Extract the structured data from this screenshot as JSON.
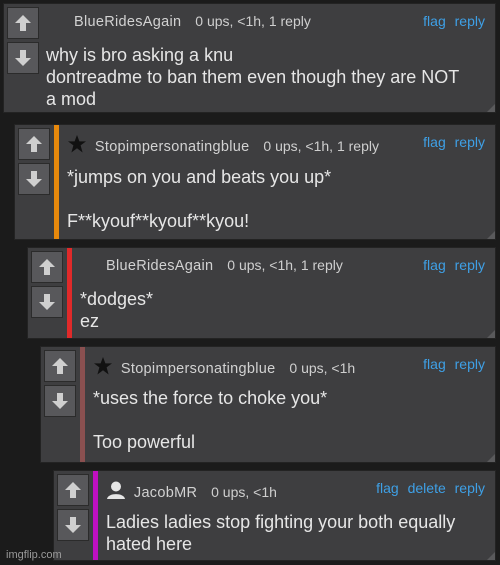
{
  "comments": [
    {
      "user": "BlueRidesAgain",
      "meta": "0 ups, <1h, 1 reply",
      "flag": "flag",
      "delete": "",
      "reply": "reply",
      "text": "why is bro asking a knu\ndontreadme to ban them even though they are NOT\na mod",
      "accent": "#3e3e40",
      "icon": "none"
    },
    {
      "user": "Stopimpersonatingblue",
      "meta": "0 ups, <1h, 1 reply",
      "flag": "flag",
      "delete": "",
      "reply": "reply",
      "text": "*jumps on you and beats you up*\n\nF**kyouf**kyouf**kyou!",
      "accent": "#e8890c",
      "icon": "star-icon"
    },
    {
      "user": "BlueRidesAgain",
      "meta": "0 ups, <1h, 1 reply",
      "flag": "flag",
      "delete": "",
      "reply": "reply",
      "text": "*dodges*\nez",
      "accent": "#e02a2a",
      "icon": "none"
    },
    {
      "user": "Stopimpersonatingblue",
      "meta": "0 ups, <1h",
      "flag": "flag",
      "delete": "",
      "reply": "reply",
      "text": "*uses the force to choke you*\n\nToo powerful",
      "accent": "#8a5050",
      "icon": "star-icon"
    },
    {
      "user": "JacobMR",
      "meta": "0 ups, <1h",
      "flag": "flag",
      "delete": "delete",
      "reply": "reply",
      "text": "Ladies ladies stop fighting your both equally\nhated here",
      "accent": "#c010c0",
      "icon": "person-icon"
    }
  ],
  "watermark": "imgflip.com"
}
